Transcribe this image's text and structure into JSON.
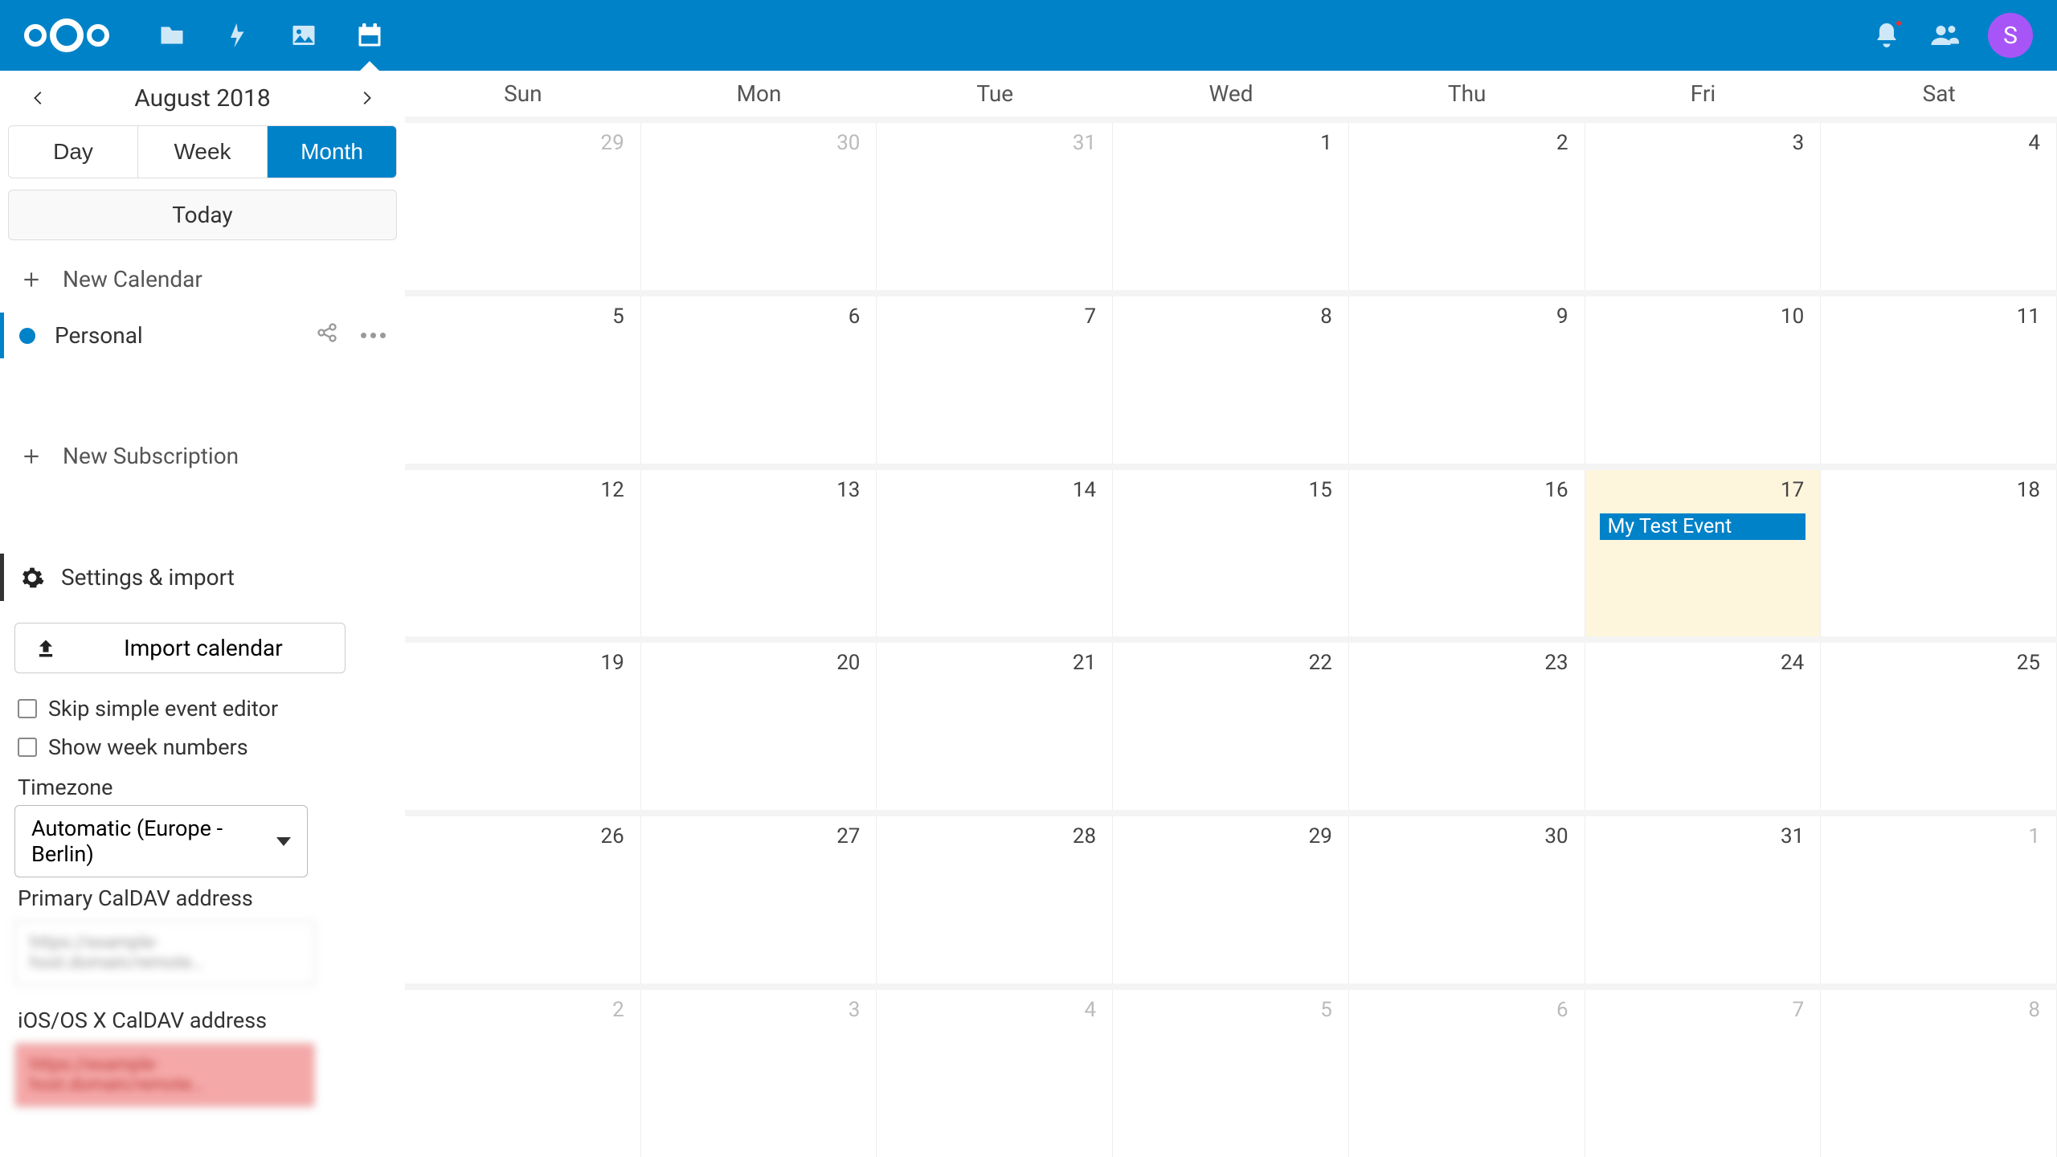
{
  "avatar_initial": "S",
  "sidebar": {
    "month_title": "August 2018",
    "views": {
      "day": "Day",
      "week": "Week",
      "month": "Month"
    },
    "today_label": "Today",
    "new_calendar": "New Calendar",
    "calendars": [
      {
        "name": "Personal"
      }
    ],
    "new_subscription": "New Subscription",
    "settings_label": "Settings & import",
    "import_label": "Import calendar",
    "skip_editor": "Skip simple event editor",
    "show_weeks": "Show week numbers",
    "timezone_label": "Timezone",
    "timezone_value": "Automatic (Europe - Berlin)",
    "primary_label": "Primary CalDAV address",
    "primary_value": "https://example-host.domain/remote…",
    "ios_label": "iOS/OS X CalDAV address",
    "ios_value": "https://example-host.domain/remote…"
  },
  "calendar": {
    "day_names": [
      "Sun",
      "Mon",
      "Tue",
      "Wed",
      "Thu",
      "Fri",
      "Sat"
    ],
    "weeks": [
      [
        {
          "n": "29",
          "other": true
        },
        {
          "n": "30",
          "other": true
        },
        {
          "n": "31",
          "other": true
        },
        {
          "n": "1"
        },
        {
          "n": "2"
        },
        {
          "n": "3"
        },
        {
          "n": "4"
        }
      ],
      [
        {
          "n": "5"
        },
        {
          "n": "6"
        },
        {
          "n": "7"
        },
        {
          "n": "8"
        },
        {
          "n": "9"
        },
        {
          "n": "10"
        },
        {
          "n": "11"
        }
      ],
      [
        {
          "n": "12"
        },
        {
          "n": "13"
        },
        {
          "n": "14"
        },
        {
          "n": "15"
        },
        {
          "n": "16"
        },
        {
          "n": "17",
          "today": true,
          "event": "My Test Event"
        },
        {
          "n": "18"
        }
      ],
      [
        {
          "n": "19"
        },
        {
          "n": "20"
        },
        {
          "n": "21"
        },
        {
          "n": "22"
        },
        {
          "n": "23"
        },
        {
          "n": "24"
        },
        {
          "n": "25"
        }
      ],
      [
        {
          "n": "26"
        },
        {
          "n": "27"
        },
        {
          "n": "28"
        },
        {
          "n": "29"
        },
        {
          "n": "30"
        },
        {
          "n": "31"
        },
        {
          "n": "1",
          "other": true
        }
      ],
      [
        {
          "n": "2",
          "other": true
        },
        {
          "n": "3",
          "other": true
        },
        {
          "n": "4",
          "other": true
        },
        {
          "n": "5",
          "other": true
        },
        {
          "n": "6",
          "other": true
        },
        {
          "n": "7",
          "other": true
        },
        {
          "n": "8",
          "other": true
        }
      ]
    ]
  }
}
